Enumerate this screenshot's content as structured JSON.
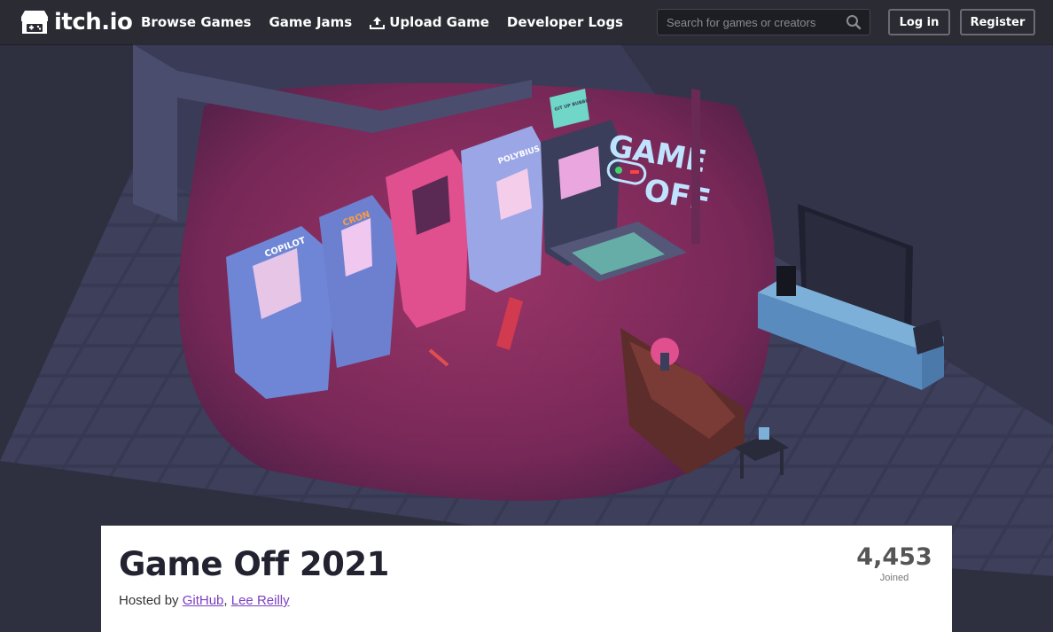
{
  "header": {
    "logo_text": "itch.io",
    "nav": [
      {
        "label": "Browse Games"
      },
      {
        "label": "Game Jams"
      },
      {
        "label": "Upload Game",
        "icon": "upload-icon"
      },
      {
        "label": "Developer Logs"
      }
    ],
    "search_placeholder": "Search for games or creators",
    "login_label": "Log in",
    "register_label": "Register"
  },
  "banner": {
    "sign_line1": "GAME",
    "sign_line2": "OFF",
    "cabinet_labels": [
      "COPILOT",
      "CRON",
      "POLYBIUS",
      "GIT UP BUBBLE"
    ]
  },
  "jam": {
    "title": "Game Off 2021",
    "hosted_prefix": "Hosted by",
    "hosts": [
      "GitHub",
      "Lee Reilly"
    ],
    "host_separator": ",",
    "joined_count": "4,453",
    "joined_label": "Joined"
  },
  "colors": {
    "topbar": "#2a2b33",
    "floor_dark": "#3a3a52",
    "floor_light": "#8a2a5c",
    "wall": "#383a54",
    "link": "#7c3fc1",
    "neon": "#bfe3ff"
  }
}
